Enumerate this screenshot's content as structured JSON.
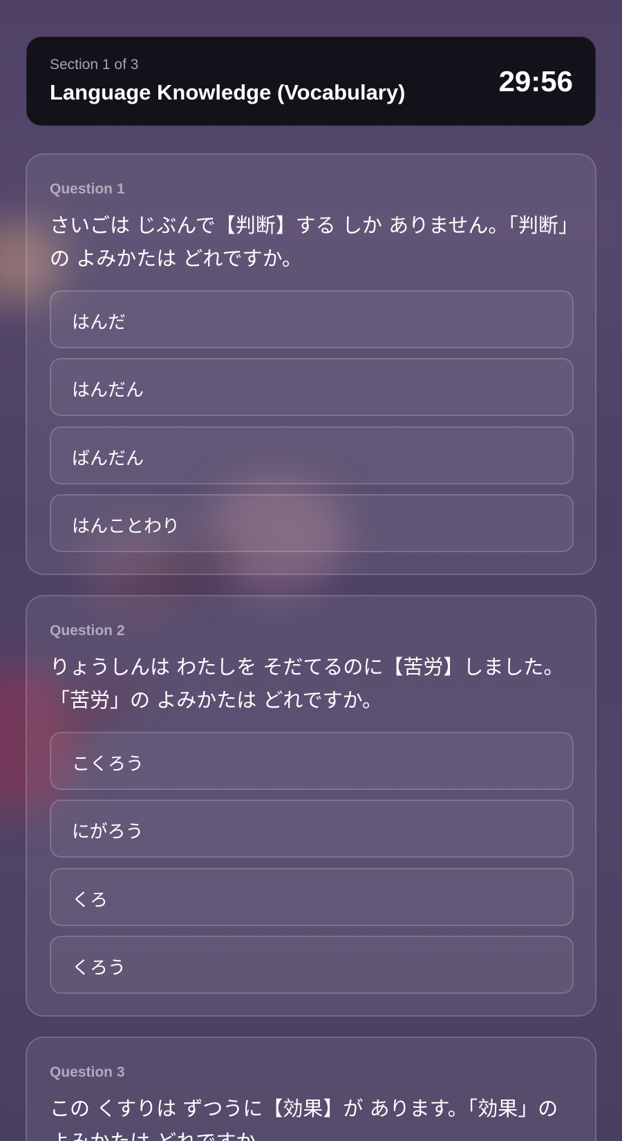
{
  "header": {
    "section": "Section 1 of 3",
    "title": "Language Knowledge (Vocabulary)",
    "timer": "29:56"
  },
  "questions": [
    {
      "label": "Question 1",
      "text": "さいごは じぶんで【判断】する しか ありません。「判断」の よみかたは どれですか。",
      "options": [
        "はんだ",
        "はんだん",
        "ばんだん",
        "はんことわり"
      ]
    },
    {
      "label": "Question 2",
      "text": "りょうしんは わたしを そだてるのに【苦労】しました。「苦労」の よみかたは どれですか。",
      "options": [
        "こくろう",
        "にがろう",
        "くろ",
        "くろう"
      ]
    },
    {
      "label": "Question 3",
      "text": "この くすりは ずつうに【効果】が あります。「効果」の よみかたは どれですか。",
      "options": []
    }
  ]
}
